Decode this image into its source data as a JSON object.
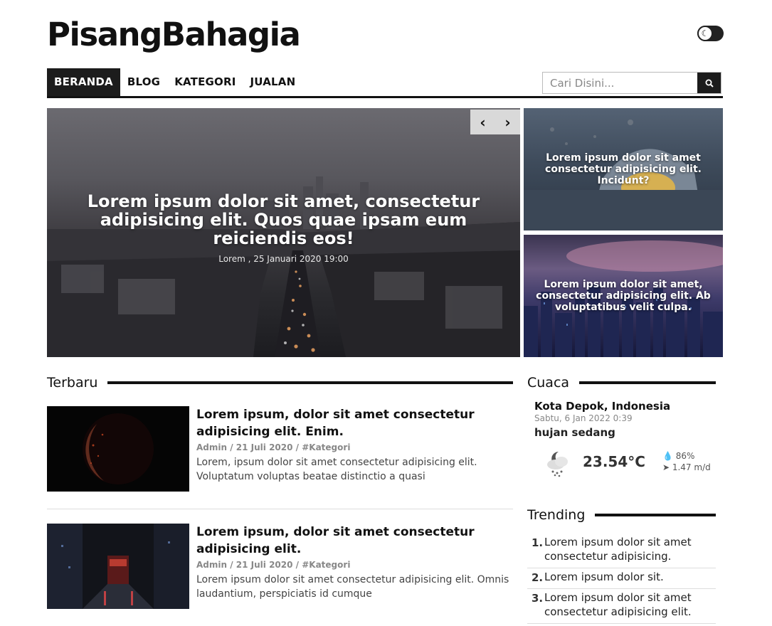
{
  "brand": {
    "name": "PisangBahagia"
  },
  "theme_toggle": {
    "icon": "moon-icon"
  },
  "nav": {
    "items": [
      "BERANDA",
      "BLOG",
      "KATEGORI",
      "JUALAN"
    ],
    "active": "BERANDA"
  },
  "search": {
    "placeholder": "Cari Disini...",
    "value": "",
    "icon": "search-icon"
  },
  "hero": {
    "title": "Lorem ipsum dolor sit amet, consectetur adipisicing elit. Quos quae ipsam eum reiciendis eos!",
    "meta": "Lorem , 25 Januari 2020 19:00",
    "prev_icon": "chevron-left-icon",
    "next_icon": "chevron-right-icon"
  },
  "side_cards": [
    {
      "title": "Lorem ipsum dolor sit amet consectetur adipisicing elit. Incidunt?"
    },
    {
      "title": "Lorem ipsum dolor sit amet, consectetur adipisicing elit. Ab voluptatibus velit culpa."
    }
  ],
  "sections": {
    "latest": "Terbaru",
    "weather": "Cuaca",
    "trending": "Trending"
  },
  "posts": [
    {
      "title": "Lorem ipsum, dolor sit amet consectetur adipisicing elit. Enim.",
      "author": "Admin",
      "date": "21 Juli 2020",
      "category": "#Kategori",
      "excerpt": "Lorem, ipsum dolor sit amet consectetur adipisicing elit. Voluptatum voluptas beatae distinctio a quasi"
    },
    {
      "title": "Lorem ipsum, dolor sit amet consectetur adipisicing elit.",
      "author": "Admin",
      "date": "21 Juli 2020",
      "category": "#Kategori",
      "excerpt": "Lorem ipsum dolor sit amet consectetur adipisicing elit. Omnis laudantium, perspiciatis id cumque"
    }
  ],
  "weather": {
    "city": "Kota Depok, Indonesia",
    "date": "Sabtu, 6 Jan 2022 0:39",
    "condition": "hujan sedang",
    "temperature": "23.54°C",
    "humidity": "86%",
    "wind": "1.47 m/d",
    "icon": "rain-cloud-moon-icon"
  },
  "trending": [
    {
      "num": "1.",
      "title": "Lorem ipsum dolor sit amet consectetur adipisicing."
    },
    {
      "num": "2.",
      "title": "Lorem ipsum dolor sit."
    },
    {
      "num": "3.",
      "title": "Lorem ipsum dolor sit amet consectetur adipisicing elit."
    }
  ]
}
